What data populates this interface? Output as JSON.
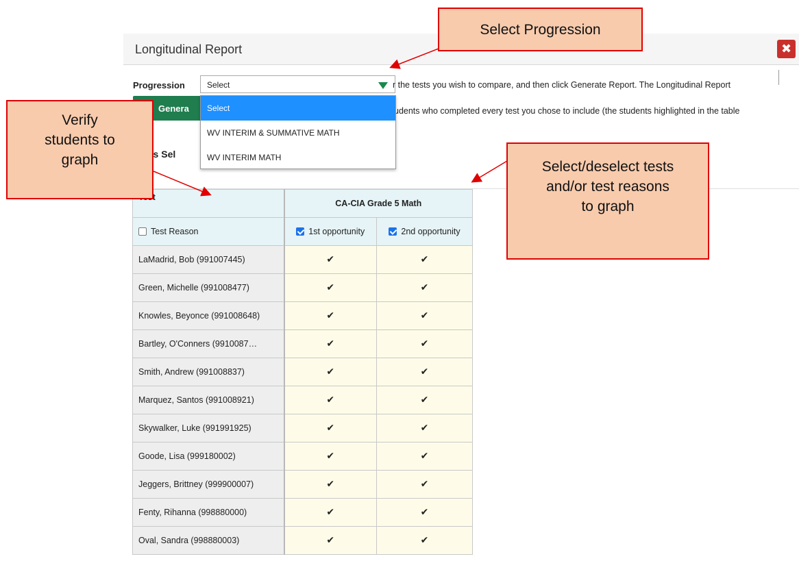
{
  "dialog": {
    "title": "Longitudinal Report",
    "close_icon": "close-x-icon"
  },
  "progression": {
    "label": "Progression",
    "selected": "Select",
    "options": [
      "Select",
      "WV INTERIM & SUMMATIVE MATH",
      "WV INTERIM MATH"
    ]
  },
  "generate_button_label": "Genera",
  "instructions": {
    "line1": "r the tests you wish to compare, and then click Generate Report. The Longitudinal Report",
    "line2": "udents who completed every test you chose to include (the students highlighted in the table"
  },
  "students_selected_label": "dents Sel",
  "table": {
    "header_test": "Test",
    "header_category": "CA-CIA Grade 5 Math",
    "test_reason_label": "Test Reason",
    "test_reason_checked": false,
    "opportunities": [
      {
        "label": "1st opportunity",
        "checked": true
      },
      {
        "label": "2nd opportunity",
        "checked": true
      }
    ],
    "check_glyph": "✔",
    "students": [
      "LaMadrid, Bob (991007445)",
      "Green, Michelle (991008477)",
      "Knowles, Beyonce (991008648)",
      "Bartley, O'Conners (9910087…",
      "Smith, Andrew (991008837)",
      "Marquez, Santos (991008921)",
      "Skywalker, Luke (991991925)",
      "Goode, Lisa (999180002)",
      "Jeggers, Brittney (999900007)",
      "Fenty, Rihanna (998880000)",
      "Oval, Sandra (998880003)"
    ]
  },
  "callouts": {
    "progression": [
      "Select Progression"
    ],
    "verify": [
      "Verify",
      "students to",
      "graph"
    ],
    "tests": [
      "Select/deselect tests",
      "and/or test reasons",
      "to graph"
    ]
  },
  "colors": {
    "callout_fill": "#f8cbad",
    "callout_border": "#e00000",
    "generate_button": "#1f7d4e",
    "dropdown_highlight": "#1e90ff",
    "close_button": "#c9302c"
  }
}
